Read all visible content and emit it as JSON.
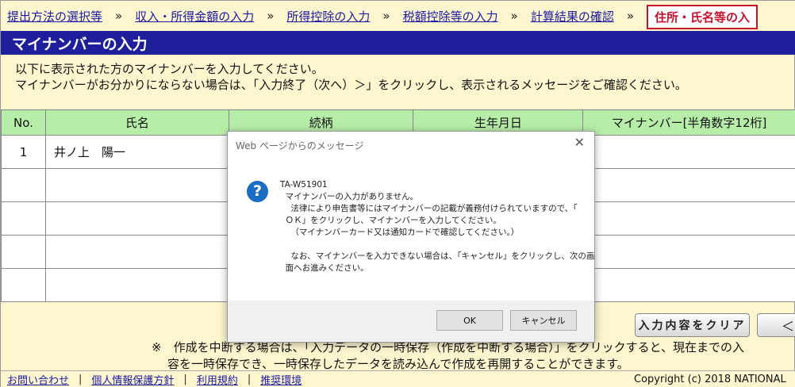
{
  "breadcrumb": {
    "steps": [
      "提出方法の選択等",
      "収入・所得金額の入力",
      "所得控除の入力",
      "税額控除等の入力",
      "計算結果の確認"
    ],
    "current": "住所・氏名等の入",
    "separator": "»"
  },
  "page": {
    "title": "マイナンバーの入力",
    "instruction_1": "以下に表示された方のマイナンバーを入力してください。",
    "instruction_2": "マイナンバーがお分かりにならない場合は、「入力終了（次へ）＞」をクリックし、表示されるメッセージをご確認ください。"
  },
  "table": {
    "headers": [
      "No.",
      "氏名",
      "続柄",
      "生年月日",
      "マイナンバー[半角数字12桁]"
    ],
    "rows": [
      {
        "no": "1",
        "name": "井ノ上　陽一"
      }
    ]
  },
  "buttons": {
    "clear": "入力内容をクリア",
    "back": "＜"
  },
  "note": {
    "line_1": "※　作成を中断する場合は、「入力データの一時保存（作成を中断する場合）」をクリックすると、現在までの入",
    "line_2": "容を一時保存でき、一時保存したデータを読み込んで作成を再開することができます。"
  },
  "footer": {
    "links": [
      "お問い合わせ",
      "個人情報保護方針",
      "利用規約",
      "推奨環境"
    ],
    "copyright": "Copyright (c) 2018 NATIONAL"
  },
  "dialog": {
    "title": "Web ページからのメッセージ",
    "icon": "question-icon",
    "message": "TA-W51901\n  マイナンバーの入力がありません。\n    法律により申告書等にはマイナンバーの記載が義務付けられていますので、「\n  ＯＫ」をクリックし、マイナンバーを入力してください。\n    （マイナンバーカード又は通知カードで確認してください。）\n\n    なお、マイナンバーを入力できない場合は、「キャンセル」をクリックし、次の画\n  面へお進みください。",
    "ok_label": "OK",
    "cancel_label": "キャンセル"
  }
}
